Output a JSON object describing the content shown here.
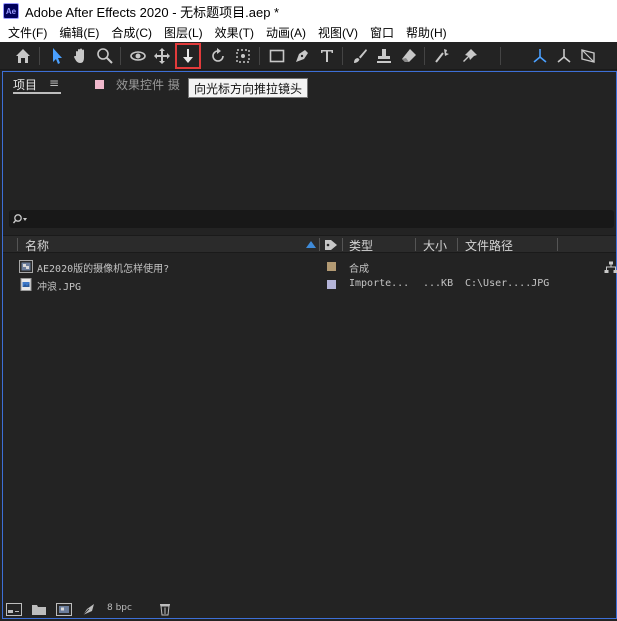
{
  "window": {
    "app_icon_text": "Ae",
    "title": "Adobe After Effects 2020 - 无标题项目.aep *"
  },
  "menu": [
    "文件(F)",
    "编辑(E)",
    "合成(C)",
    "图层(L)",
    "效果(T)",
    "动画(A)",
    "视图(V)",
    "窗口",
    "帮助(H)"
  ],
  "toolbar": {
    "tools": [
      {
        "name": "home-icon"
      },
      {
        "name": "selection-tool-icon"
      },
      {
        "name": "hand-tool-icon"
      },
      {
        "name": "zoom-tool-icon"
      },
      {
        "name": "orbit-camera-icon"
      },
      {
        "name": "track-xy-camera-icon"
      },
      {
        "name": "dolly-camera-icon",
        "active": true
      },
      {
        "name": "rotation-tool-icon"
      },
      {
        "name": "pan-behind-icon"
      },
      {
        "name": "rectangle-tool-icon"
      },
      {
        "name": "pen-tool-icon"
      },
      {
        "name": "type-tool-icon"
      },
      {
        "name": "brush-tool-icon"
      },
      {
        "name": "clone-stamp-icon"
      },
      {
        "name": "eraser-tool-icon"
      },
      {
        "name": "roto-brush-icon"
      },
      {
        "name": "puppet-pin-icon"
      },
      {
        "name": "local-axis-icon"
      },
      {
        "name": "world-axis-icon"
      },
      {
        "name": "view-axis-icon"
      }
    ],
    "tooltip": "向光标方向推拉镜头"
  },
  "panel": {
    "tab_project": "项目",
    "tab_menu": "≡",
    "tab_effects": "效果控件 摄",
    "search_placeholder": "",
    "columns": {
      "name": "名称",
      "type": "类型",
      "size": "大小",
      "path": "文件路径"
    },
    "items": [
      {
        "name": "AE2020版的摄像机怎样使用?",
        "type": "合成",
        "size": "",
        "path": "",
        "label_color": "#b39a73",
        "icon": "composition-icon"
      },
      {
        "name": "冲浪.JPG",
        "type": "Importe...",
        "size": "...KB",
        "path": "C:\\User....JPG",
        "label_color": "#b4b4d8",
        "icon": "image-file-icon"
      }
    ],
    "footer": {
      "bpc": "8 bpc"
    }
  },
  "colors": {
    "accent_blue": "#3f8bd9",
    "panel_border": "#3d6fd6",
    "active_tool_outline": "#e23b3b"
  }
}
